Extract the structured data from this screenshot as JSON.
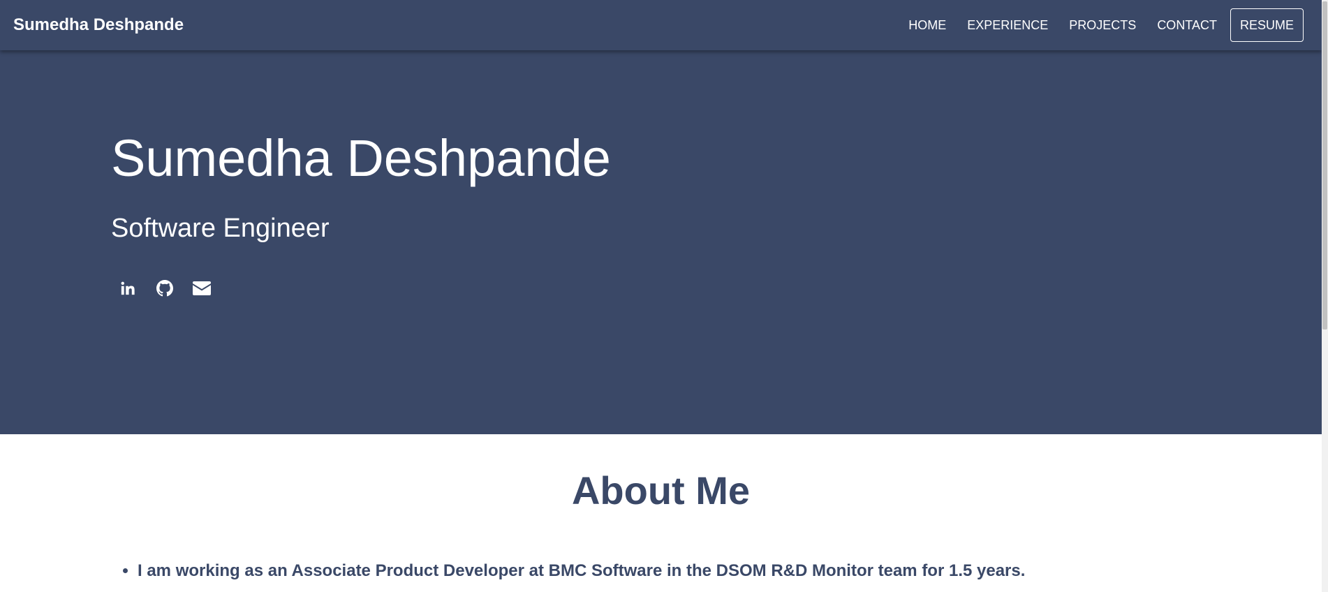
{
  "navbar": {
    "brand": "Sumedha Deshpande",
    "links": [
      {
        "label": "HOME"
      },
      {
        "label": "EXPERIENCE"
      },
      {
        "label": "PROJECTS"
      },
      {
        "label": "CONTACT"
      }
    ],
    "resume_label": "RESUME"
  },
  "hero": {
    "name": "Sumedha Deshpande",
    "title": "Software Engineer",
    "socials": [
      {
        "icon": "linkedin-icon"
      },
      {
        "icon": "github-icon"
      },
      {
        "icon": "envelope-icon"
      }
    ]
  },
  "about": {
    "heading": "About Me",
    "items": [
      "I am working as an Associate Product Developer at BMC Software in the DSOM R&D Monitor team for 1.5 years."
    ]
  },
  "colors": {
    "primary": "#3a4867",
    "text_on_primary": "#ffffff",
    "background": "#ffffff"
  }
}
